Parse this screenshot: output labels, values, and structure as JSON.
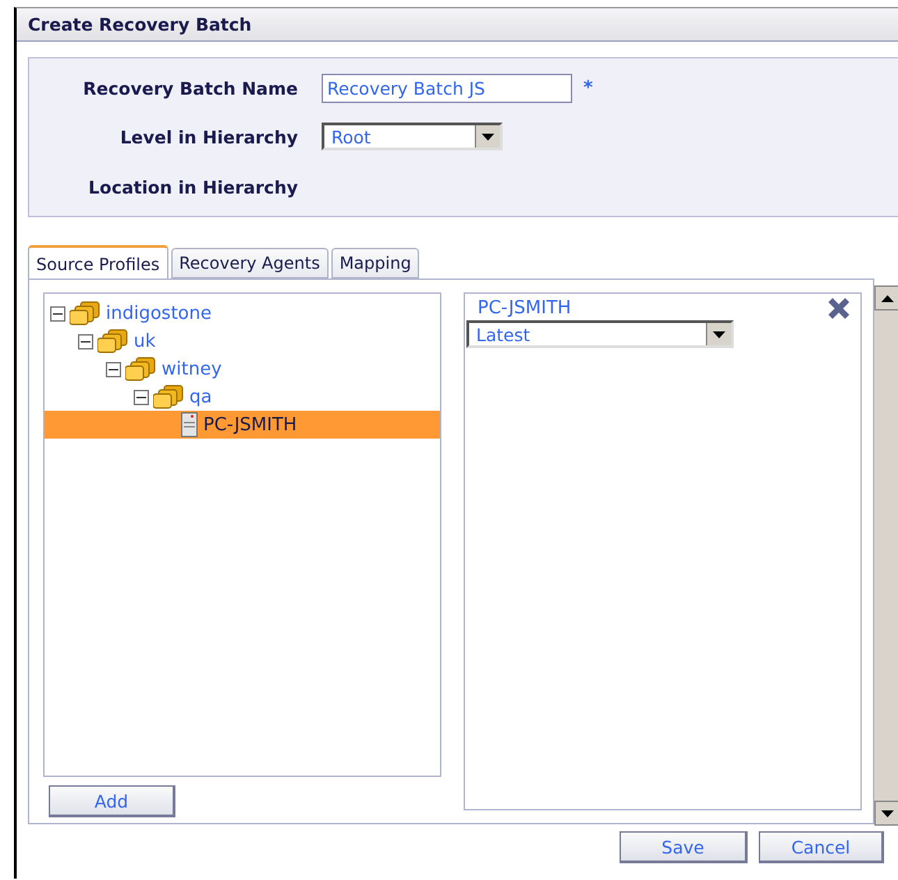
{
  "window": {
    "title": "Create Recovery Batch"
  },
  "form": {
    "name_label": "Recovery Batch Name",
    "name_value": "Recovery Batch JS",
    "required_mark": "*",
    "level_label": "Level in Hierarchy",
    "level_value": "Root",
    "location_label": "Location in Hierarchy"
  },
  "tabs": [
    {
      "label": "Source Profiles",
      "selected": true
    },
    {
      "label": "Recovery Agents",
      "selected": false
    },
    {
      "label": "Mapping",
      "selected": false
    }
  ],
  "tree": [
    {
      "label": "indigostone",
      "kind": "group",
      "expanded": true,
      "selected": false,
      "children": [
        {
          "label": "uk",
          "kind": "group",
          "expanded": true,
          "selected": false,
          "children": [
            {
              "label": "witney",
              "kind": "group",
              "expanded": true,
              "selected": false,
              "children": [
                {
                  "label": "qa",
                  "kind": "group",
                  "expanded": true,
                  "selected": false,
                  "children": [
                    {
                      "label": "PC-JSMITH",
                      "kind": "computer",
                      "selected": true
                    }
                  ]
                }
              ]
            }
          ]
        }
      ]
    }
  ],
  "add_button": "Add",
  "profiles": [
    {
      "name": "PC-JSMITH",
      "version": "Latest"
    }
  ],
  "buttons": [
    "Save",
    "Cancel"
  ]
}
